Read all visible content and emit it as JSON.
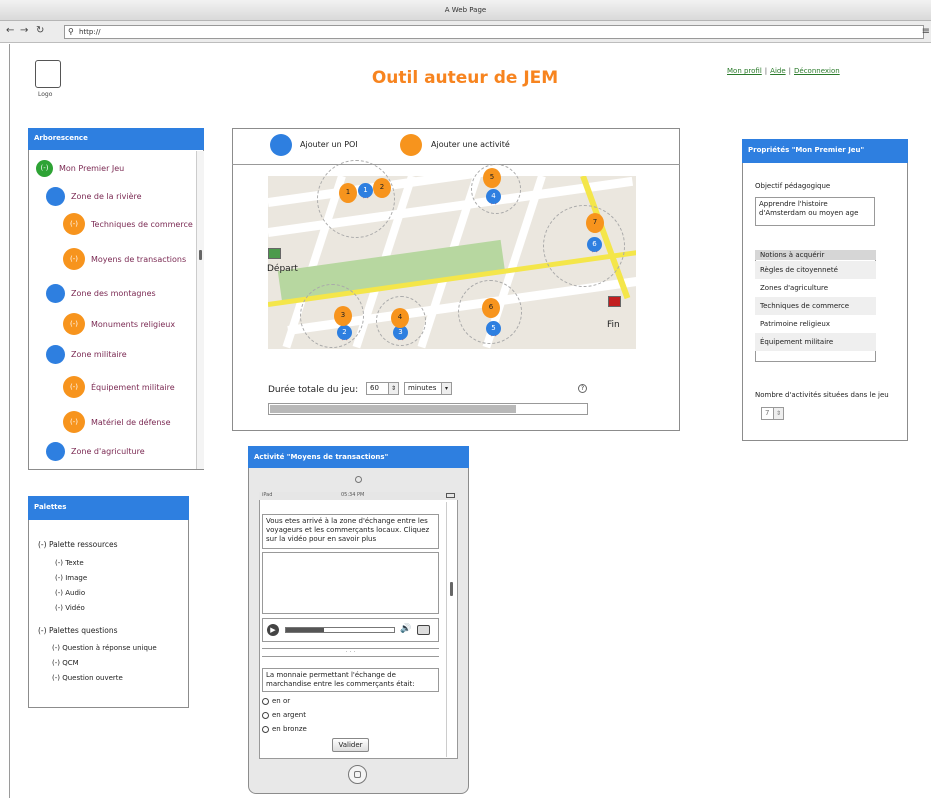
{
  "browser": {
    "window_title": "A Web Page",
    "url": "http://"
  },
  "header": {
    "logo_label": "Logo",
    "title": "Outil auteur de JEM",
    "links": [
      "Mon profil",
      "Aide",
      "Déconnexion"
    ]
  },
  "tree": {
    "title": "Arborescence",
    "items": [
      {
        "label": "Mon Premier Jeu",
        "level": 0,
        "marker": "(-)",
        "color": "green"
      },
      {
        "label": "Zone de la rivière",
        "level": 1,
        "marker": "",
        "color": "blue"
      },
      {
        "label": "Techniques de commerce",
        "level": 2,
        "marker": "(-)",
        "color": "orange"
      },
      {
        "label": "Moyens de transactions",
        "level": 2,
        "marker": "(-)",
        "color": "orange"
      },
      {
        "label": "Zone des montagnes",
        "level": 1,
        "marker": "",
        "color": "blue"
      },
      {
        "label": "Monuments religieux",
        "level": 2,
        "marker": "(-)",
        "color": "orange"
      },
      {
        "label": "Zone militaire",
        "level": 1,
        "marker": "",
        "color": "blue"
      },
      {
        "label": "Équipement militaire",
        "level": 2,
        "marker": "(-)",
        "color": "orange"
      },
      {
        "label": "Matériel de défense",
        "level": 2,
        "marker": "(-)",
        "color": "orange"
      },
      {
        "label": "Zone d'agriculture",
        "level": 1,
        "marker": "",
        "color": "blue"
      }
    ]
  },
  "palettes": {
    "title": "Palettes",
    "resources_label": "(-)   Palette ressources",
    "resources": [
      "(-) Texte",
      "(-) Image",
      "(-) Audio",
      "(-) Vidéo"
    ],
    "questions_label": "(-)   Palettes questions",
    "questions": [
      "(-) Question à réponse unique",
      "(-) QCM",
      "(-) Question ouverte"
    ]
  },
  "map_panel": {
    "add_poi": "Ajouter un POI",
    "add_activity": "Ajouter une activité",
    "start_label": "Départ",
    "end_label": "Fin",
    "poi_blue": [
      "1",
      "2",
      "3",
      "4",
      "5",
      "6"
    ],
    "poi_orange": [
      "1",
      "2",
      "3",
      "4",
      "5",
      "6",
      "7"
    ],
    "duration_label": "Durée totale du jeu:",
    "duration_value": "60",
    "duration_unit": "minutes",
    "progress": 0.78
  },
  "properties": {
    "title": "Propriétés \"Mon Premier Jeu\"",
    "objective_label": "Objectif pédagogique",
    "objective_value": "Apprendre l'histoire d'Amsterdam ou moyen age",
    "notions_header": "Notions à acquérir",
    "notions": [
      "Règles de citoyenneté",
      "Zones d'agriculture",
      "Techniques de commerce",
      "Patrimoine religieux",
      "Équipement militaire"
    ],
    "activities_count_label": "Nombre d'activités situées dans le jeu",
    "activities_count": "7"
  },
  "activity": {
    "title": "Activité \"Moyens de transactions\"",
    "status_left": "iPad",
    "status_time": "05:34 PM",
    "intro_text": "Vous etes arrivé à la zone d'échange entre les voyageurs et les commerçants locaux. Cliquez sur la vidéo pour en savoir plus",
    "question_text": "La monnaie permettant l'échange de marchandise entre les commerçants était:",
    "options": [
      "en or",
      "en argent",
      "en bronze"
    ],
    "submit_label": "Valider",
    "divider_dots": "· · ·"
  },
  "colors": {
    "accent_blue": "#2e7fe0",
    "accent_orange": "#f7941d",
    "title_orange": "#f7841f",
    "root_green": "#2ea335",
    "link_green": "#2a7a2a"
  }
}
